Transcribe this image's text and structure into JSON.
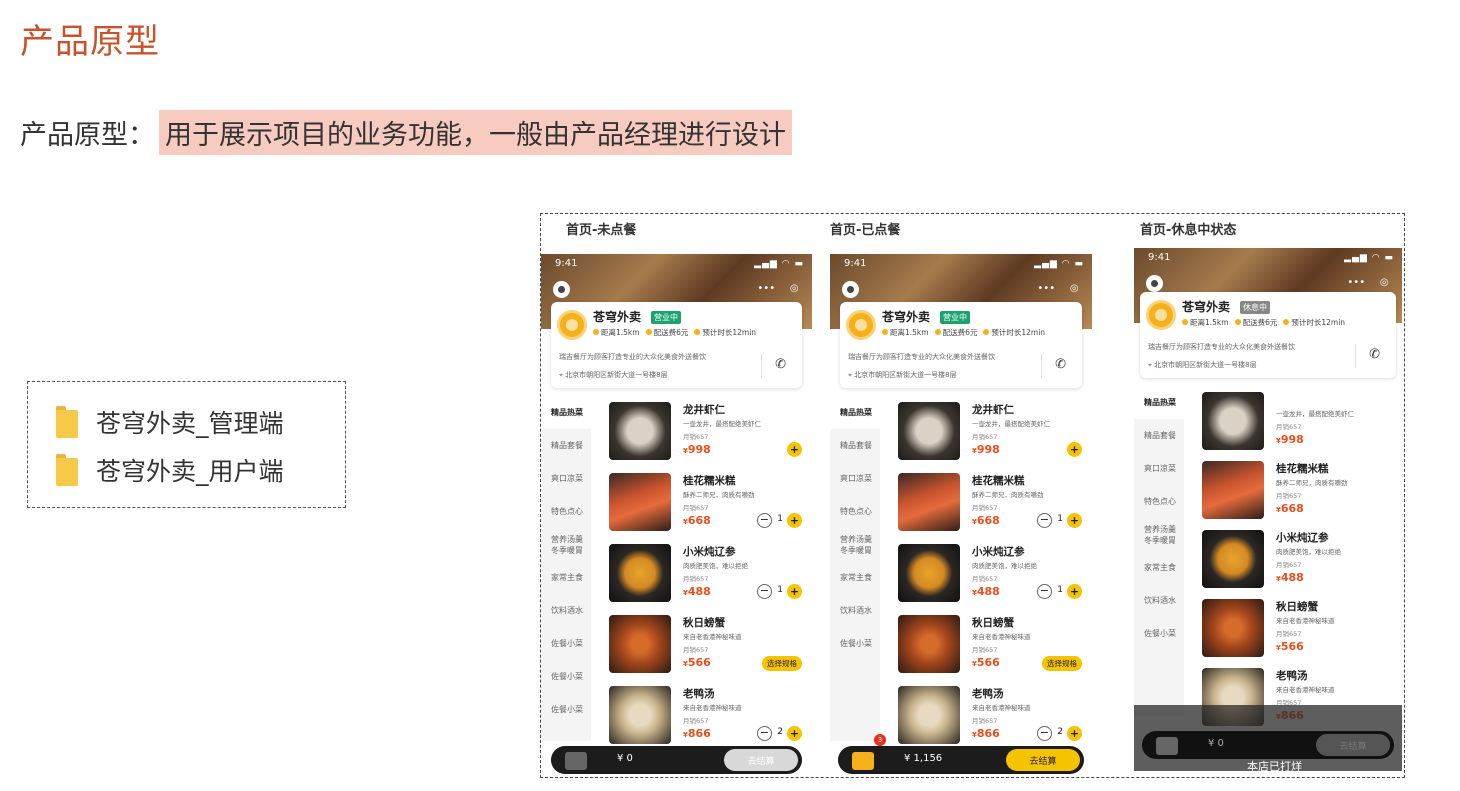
{
  "page": {
    "title": "产品原型",
    "subtitle_prefix": "产品原型：",
    "subtitle_highlight": "用于展示项目的业务功能，一般由产品经理进行设计"
  },
  "folders": [
    {
      "icon": "folder-icon",
      "label": "苍穹外卖_管理端"
    },
    {
      "icon": "folder-icon",
      "label": "苍穹外卖_用户端"
    }
  ],
  "screens": [
    {
      "title": "首页-未点餐",
      "time": "9:41",
      "shop_name": "苍穹外卖",
      "status_badge": "营业中",
      "distance": "距离1.5km",
      "delivery_fee": "配送费6元",
      "eta": "预计时长12min",
      "intro": "瑞吉餐厅为顾客打造专业的大众化美食外送餐饮",
      "address": "北京市朝阳区新街大道一号楼8层",
      "categories": [
        "精品热菜",
        "精品套餐",
        "爽口凉菜",
        "特色点心",
        "营养汤羹 冬季暖胃",
        "家常主食",
        "饮料酒水",
        "佐餐小菜",
        "佐餐小菜",
        "佐餐小菜"
      ],
      "dishes": [
        {
          "name": "龙井虾仁",
          "desc": "一壶龙井，最搭配绝美虾仁",
          "sales": "月销657",
          "price": "998",
          "qty": ""
        },
        {
          "name": "桂花糯米糕",
          "desc": "酥养二师兄，肉质有嚼劲",
          "sales": "月销657",
          "price": "668",
          "qty": "1"
        },
        {
          "name": "小米炖辽参",
          "desc": "肉质肥美饱，难以拒绝",
          "sales": "月销657",
          "price": "488",
          "qty": "1"
        },
        {
          "name": "秋日螃蟹",
          "desc": "来自老香港神秘味道",
          "sales": "月销657",
          "price": "566",
          "spec": "选择规格"
        },
        {
          "name": "老鸭汤",
          "desc": "来自老香港神秘味道",
          "sales": "月销657",
          "price": "866",
          "qty": "2"
        }
      ],
      "cart_total": "¥ 0",
      "checkout": "去结算"
    },
    {
      "title": "首页-已点餐",
      "time": "9:41",
      "shop_name": "苍穹外卖",
      "status_badge": "营业中",
      "distance": "距离1.5km",
      "delivery_fee": "配送费6元",
      "eta": "预计时长12min",
      "intro": "瑞吉餐厅为顾客打造专业的大众化美食外送餐饮",
      "address": "北京市朝阳区新街大道一号楼8层",
      "categories": [
        "精品热菜",
        "精品套餐",
        "爽口凉菜",
        "特色点心",
        "营养汤羹 冬季暖胃",
        "家常主食",
        "饮料酒水",
        "佐餐小菜"
      ],
      "dishes": [
        {
          "name": "龙井虾仁",
          "desc": "一壶龙井，最搭配绝美虾仁",
          "sales": "月销657",
          "price": "998",
          "qty": ""
        },
        {
          "name": "桂花糯米糕",
          "desc": "酥养二师兄，肉质有嚼劲",
          "sales": "月销657",
          "price": "668",
          "qty": "1"
        },
        {
          "name": "小米炖辽参",
          "desc": "肉质肥美饱，难以拒绝",
          "sales": "月销657",
          "price": "488",
          "qty": "1"
        },
        {
          "name": "秋日螃蟹",
          "desc": "来自老香港神秘味道",
          "sales": "月销657",
          "price": "566",
          "spec": "选择规格"
        },
        {
          "name": "老鸭汤",
          "desc": "来自老香港神秘味道",
          "sales": "月销657",
          "price": "866",
          "qty": "2"
        }
      ],
      "cart_count": "3",
      "cart_total": "¥ 1,156",
      "checkout": "去结算"
    },
    {
      "title": "首页-休息中状态",
      "time": "9:41",
      "shop_name": "苍穹外卖",
      "status_badge": "休息中",
      "distance": "距离1.5km",
      "delivery_fee": "配送费6元",
      "eta": "预计时长12min",
      "intro": "瑞吉餐厅为顾客打造专业的大众化美食外送餐饮",
      "address": "北京市朝阳区新街大道一号楼8层",
      "categories": [
        "精品热菜",
        "精品套餐",
        "爽口凉菜",
        "特色点心",
        "营养汤羹 冬季暖胃",
        "家常主食",
        "饮料酒水",
        "佐餐小菜"
      ],
      "dishes": [
        {
          "name": "",
          "desc": "一壶龙井，最搭配绝美虾仁",
          "sales": "月销657",
          "price": "998"
        },
        {
          "name": "桂花糯米糕",
          "desc": "酥养二师兄，肉质有嚼劲",
          "sales": "月销657",
          "price": "668"
        },
        {
          "name": "小米炖辽参",
          "desc": "肉质肥美饱，难以拒绝",
          "sales": "月销657",
          "price": "488"
        },
        {
          "name": "秋日螃蟹",
          "desc": "来自老香港神秘味道",
          "sales": "月销657",
          "price": "566"
        },
        {
          "name": "老鸭汤",
          "desc": "来自老香港神秘味道",
          "sales": "月销657",
          "price": "866"
        }
      ],
      "cart_total": "¥ 0",
      "closed_text": "本店已打烊",
      "checkout": "去结算"
    }
  ],
  "colors": {
    "accent": "#c8522a",
    "highlight": "#f8cbc0",
    "brand_yellow": "#f5c300",
    "price_red": "#e6501e",
    "open_green": "#1aa36f"
  }
}
